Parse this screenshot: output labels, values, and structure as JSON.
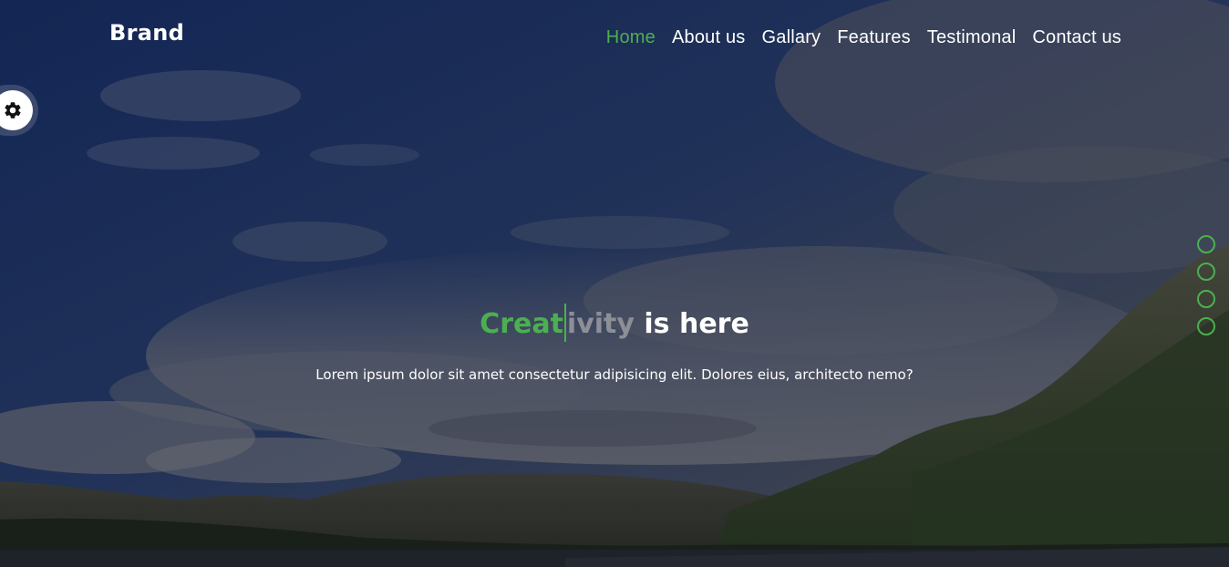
{
  "brand": "Brand",
  "nav": {
    "items": [
      {
        "label": "Home",
        "active": true
      },
      {
        "label": "About us",
        "active": false
      },
      {
        "label": "Gallary",
        "active": false
      },
      {
        "label": "Features",
        "active": false
      },
      {
        "label": "Testimonal",
        "active": false
      },
      {
        "label": "Contact us",
        "active": false
      }
    ]
  },
  "settings": {
    "icon": "gear-icon"
  },
  "hero": {
    "headline_typed": "Creat",
    "headline_rest": "ivity",
    "headline_suffix": " is here",
    "subtitle": "Lorem ipsum dolor sit amet consectetur adipisicing elit. Dolores eius, architecto nemo?"
  },
  "slider": {
    "dot_count": 4
  },
  "colors": {
    "accent": "#4caf50",
    "text": "#ffffff",
    "typed_rest": "#8c8f96"
  }
}
